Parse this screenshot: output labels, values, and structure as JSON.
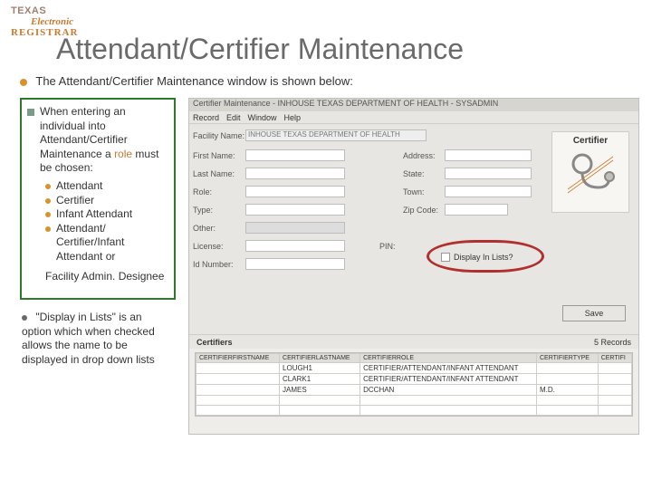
{
  "logo": {
    "l1": "TEXAS",
    "l2": "Electronic",
    "l3": "REGISTRAR"
  },
  "page": {
    "title": "Attendant/Certifier Maintenance",
    "subtitle": "The Attendant/Certifier Maintenance window is shown below:"
  },
  "left": {
    "intro": "When entering an individual into Attendant/Certifier Maintenance a ",
    "role_word": "role",
    "intro2": " must be chosen:",
    "bullets": [
      "Attendant",
      "Certifier",
      "Infant Attendant",
      "Attendant/ Certifier/Infant Attendant or"
    ],
    "tail": "Facility Admin. Designee",
    "note": "\"Display in Lists\" is an option which when checked allows the name to be displayed in drop down lists"
  },
  "window": {
    "title": "Certifier Maintenance - INHOUSE TEXAS DEPARTMENT OF HEALTH - SYSADMIN",
    "menus": [
      "Record",
      "Edit",
      "Window",
      "Help"
    ],
    "labels": {
      "facility": "Facility Name:",
      "fname": "First Name:",
      "lname": "Last Name:",
      "role": "Role:",
      "type": "Type:",
      "other": "Other:",
      "license": "License:",
      "pin": "PIN:",
      "idnum": "Id Number:",
      "address": "Address:",
      "state": "State:",
      "town": "Town:",
      "zip": "Zip Code:",
      "display": "Display In Lists?"
    },
    "facility_value": "INHOUSE TEXAS DEPARTMENT OF HEALTH",
    "id_heading": "Certifier",
    "save": "Save",
    "section": "Certifiers",
    "records": "5 Records",
    "cols": [
      "CERTIFIERFIRSTNAME",
      "CERTIFIERLASTNAME",
      "CERTIFIERROLE",
      "CERTIFIERTYPE",
      "CERTIFI"
    ],
    "rows": [
      [
        "",
        "LOUGH1",
        "CERTIFIER/ATTENDANT/INFANT ATTENDANT",
        ""
      ],
      [
        "",
        "CLARK1",
        "CERTIFIER/ATTENDANT/INFANT ATTENDANT",
        ""
      ],
      [
        "",
        "JAMES",
        "DCCHAN",
        "M.D."
      ]
    ]
  }
}
